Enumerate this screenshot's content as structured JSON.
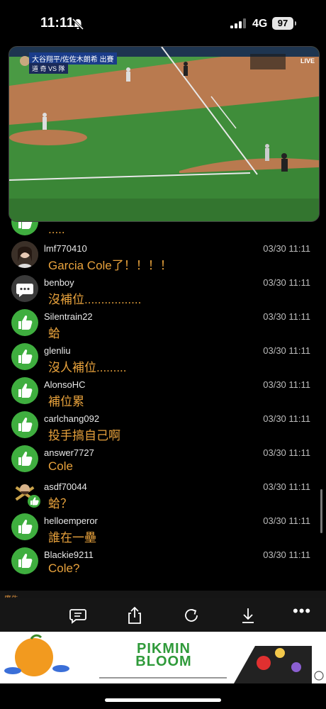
{
  "status_bar": {
    "time": "11:11",
    "network": "4G",
    "battery": "97"
  },
  "video": {
    "caption_line1": "大谷翔平/佐佐木朗希 出賽",
    "caption_line2": "道 奇 VS 隊 ",
    "channel_badge": "LIVE"
  },
  "comments": [
    {
      "user": "",
      "time": "",
      "message": ".....",
      "avatar": "like-icon"
    },
    {
      "user": "lmf770410",
      "time": "03/30 11:11",
      "message": "Garcia Cole了！！！！",
      "avatar": "user-photo"
    },
    {
      "user": "benboy",
      "time": "03/30 11:11",
      "message": "沒補位.................",
      "avatar": "chat-bubble-icon"
    },
    {
      "user": "Silentrain22",
      "time": "03/30 11:11",
      "message": "蛤",
      "avatar": "like-icon"
    },
    {
      "user": "glenliu",
      "time": "03/30 11:11",
      "message": "沒人補位.........",
      "avatar": "like-icon"
    },
    {
      "user": "AlonsoHC",
      "time": "03/30 11:11",
      "message": "補位累",
      "avatar": "like-icon"
    },
    {
      "user": "carlchang092",
      "time": "03/30 11:11",
      "message": "投手搞自己啊",
      "avatar": "like-icon"
    },
    {
      "user": "answer7727",
      "time": "03/30 11:11",
      "message": "Cole",
      "avatar": "like-icon"
    },
    {
      "user": "asdf70044",
      "time": "03/30 11:11",
      "message": "蛤？",
      "avatar": "cartoon-avatar"
    },
    {
      "user": "helloemperor",
      "time": "03/30 11:11",
      "message": "誰在一壘",
      "avatar": "like-icon"
    },
    {
      "user": "Blackie9211",
      "time": "03/30 11:11",
      "message": "Cole?",
      "avatar": "like-icon"
    }
  ],
  "toolbar": [
    "comment-icon",
    "share-icon",
    "refresh-icon",
    "download-icon",
    "more-icon"
  ],
  "ad": {
    "title_line1": "PIKMIN",
    "title_line2": "BLOOM",
    "label": "廣告"
  },
  "colors": {
    "message": "#e8a23c",
    "like_avatar": "#3fae3f"
  }
}
